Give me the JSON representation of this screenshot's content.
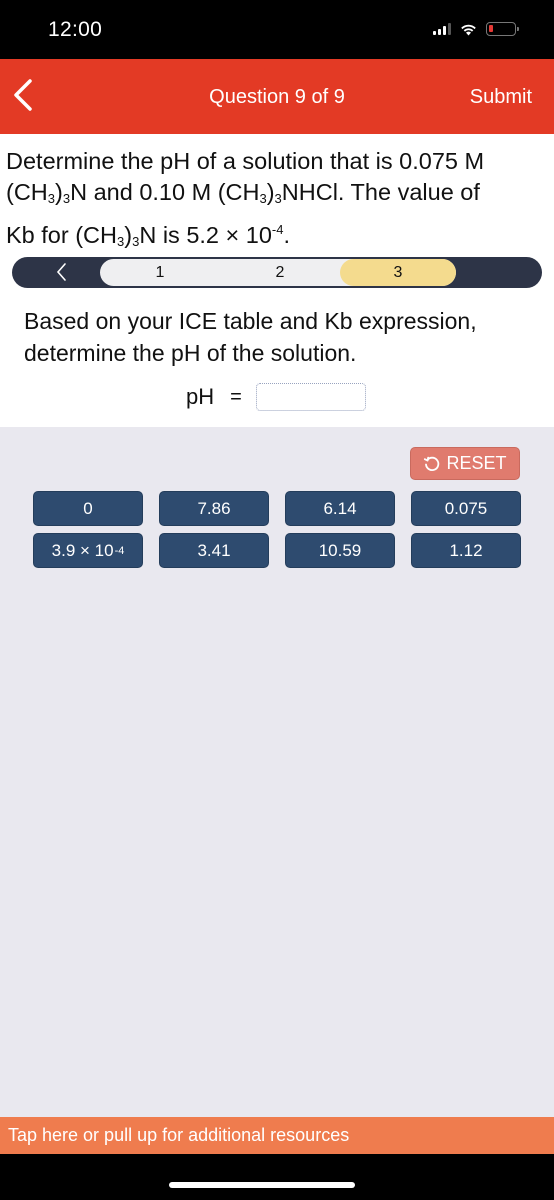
{
  "status_bar": {
    "time": "12:00",
    "icons": [
      "signal-icon",
      "wifi-icon",
      "battery-low-icon"
    ],
    "battery_color": "#e53935"
  },
  "nav": {
    "back_icon": "chevron-left-icon",
    "title": "Question 9 of 9",
    "submit_label": "Submit",
    "background": "#e33a25"
  },
  "question": {
    "line1": "Determine the pH of a solution that is 0.075 M",
    "amine": "(CH",
    "sub3": "3",
    "close": ")",
    "n": "N",
    "and_text": " and 0.10 M ",
    "nhcl": "NHCl",
    "value_text": ". The value of",
    "kb_for": "Kb for ",
    "is_text": " is 5.2 × 10",
    "exp": "-4",
    "period": "."
  },
  "steps": {
    "prev_icon": "chevron-left-icon",
    "items": [
      {
        "label": "1",
        "active": false
      },
      {
        "label": "2",
        "active": false
      },
      {
        "label": "3",
        "active": true
      }
    ],
    "active_color": "#f4db8e"
  },
  "prompt": {
    "text": "Based on your ICE table and Kb expression, determine the pH of the solution.",
    "ph_label": "pH",
    "equals": "=",
    "answer_value": ""
  },
  "reset": {
    "icon": "undo-icon",
    "label": "RESET",
    "color": "#e07b6e"
  },
  "tiles": {
    "color": "#2e4b6f",
    "items": [
      {
        "label": "0"
      },
      {
        "label": "7.86"
      },
      {
        "label": "6.14"
      },
      {
        "label": "0.075"
      },
      {
        "label": "3.9 × 10",
        "exp": "-4"
      },
      {
        "label": "3.41"
      },
      {
        "label": "10.59"
      },
      {
        "label": "1.12"
      }
    ]
  },
  "footer": {
    "resources_label": "Tap here or pull up for additional resources",
    "color": "#ef7c4e"
  }
}
